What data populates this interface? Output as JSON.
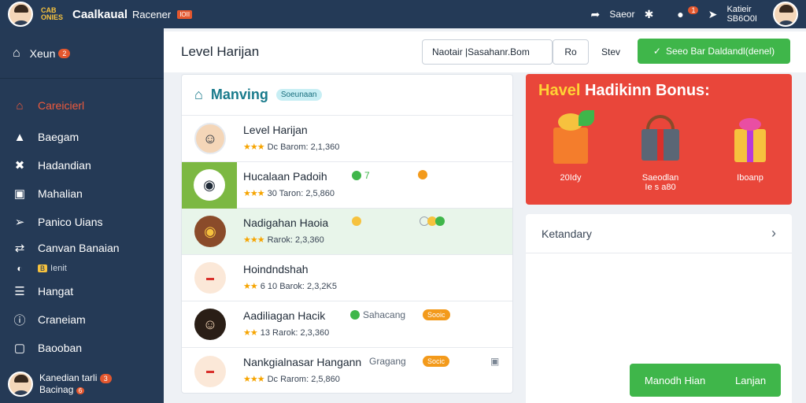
{
  "topbar": {
    "brand_logo": "CAB ONIES",
    "brand_name": "Caalkaual",
    "brand_sub": "Racener",
    "brand_badge": "IOII",
    "action_label": "Saeor",
    "notif_count": "1",
    "user_line1": "Katieir",
    "user_line2": "SB6O0I"
  },
  "sidebar": {
    "home_label": "Xeun",
    "home_badge": "2",
    "items": [
      {
        "label": "Careicierl",
        "icon": "home-icon"
      },
      {
        "label": "Baegam",
        "icon": "thumb-icon"
      },
      {
        "label": "Hadandian",
        "icon": "tools-icon"
      },
      {
        "label": "Mahalian",
        "icon": "box-icon"
      },
      {
        "label": "Panico Uians",
        "icon": "pin-icon"
      },
      {
        "label": "Canvan Banaian",
        "icon": "swap-icon"
      },
      {
        "label": "Hangat",
        "icon": "list-icon"
      },
      {
        "label": "Craneiam",
        "icon": "info-icon"
      },
      {
        "label": "Baooban",
        "icon": "square-icon"
      }
    ],
    "sub_chip": "B",
    "sub_label": "Ienit",
    "user_name": "Kanedian tarli",
    "user_sub": "Bacinag",
    "user_badge": "3",
    "user_sub_badge": "6"
  },
  "header": {
    "title": "Level Harijan",
    "search_value": "Naotair |Sasahanr.Bom",
    "btn_small": "Ro",
    "btn_text": "Stev",
    "btn_green": "Seeo Bar Daldandl(denel)"
  },
  "list": {
    "title": "Manving",
    "chip": "Soeunaan",
    "rows": [
      {
        "name": "Level Harijan",
        "meta": "Dc Barom: 2,1,360",
        "stars": "★★★",
        "tag": "",
        "pill": ""
      },
      {
        "name": "Hucalaan Padoih",
        "meta": "30 Taron: 2,5,860",
        "stars": "★★★",
        "tag": "7",
        "pill": ""
      },
      {
        "name": "Nadigahan Haoia",
        "meta": "Rarok: 2,3,360",
        "stars": "★★★",
        "tag": "",
        "pill": ""
      },
      {
        "name": "Hoindndshah",
        "meta": "6 10 Barok: 2,3,2K5",
        "stars": "★★",
        "tag": "",
        "pill": ""
      },
      {
        "name": "Aadiliagan Hacik",
        "meta": "13 Rarok: 2,3,360",
        "stars": "★★",
        "tag": "Sahacang",
        "pill": "Sooic"
      },
      {
        "name": "Nankgialnasar Hangann",
        "meta": "Dc Rarom: 2,5,860",
        "stars": "★★★",
        "tag": "Gragang",
        "pill": "Socic"
      }
    ]
  },
  "bonus": {
    "title_hl": "Havel",
    "title_rest": "Hadikinn Bonus:",
    "items": [
      {
        "label": "20Idy",
        "icon": "gift-box-icon"
      },
      {
        "label": "Saeodlan\nIe s a80",
        "icon": "basket-icon"
      },
      {
        "label": "Iboanp",
        "icon": "present-icon"
      }
    ]
  },
  "calendar": {
    "title": "Ketandary",
    "btn_left": "Manodh Hian",
    "btn_right": "Lanjan"
  },
  "colors": {
    "navy": "#253a56",
    "green": "#3fb64a",
    "red": "#e9463a",
    "teal": "#1a7b8c",
    "orange": "#f39a1b"
  }
}
